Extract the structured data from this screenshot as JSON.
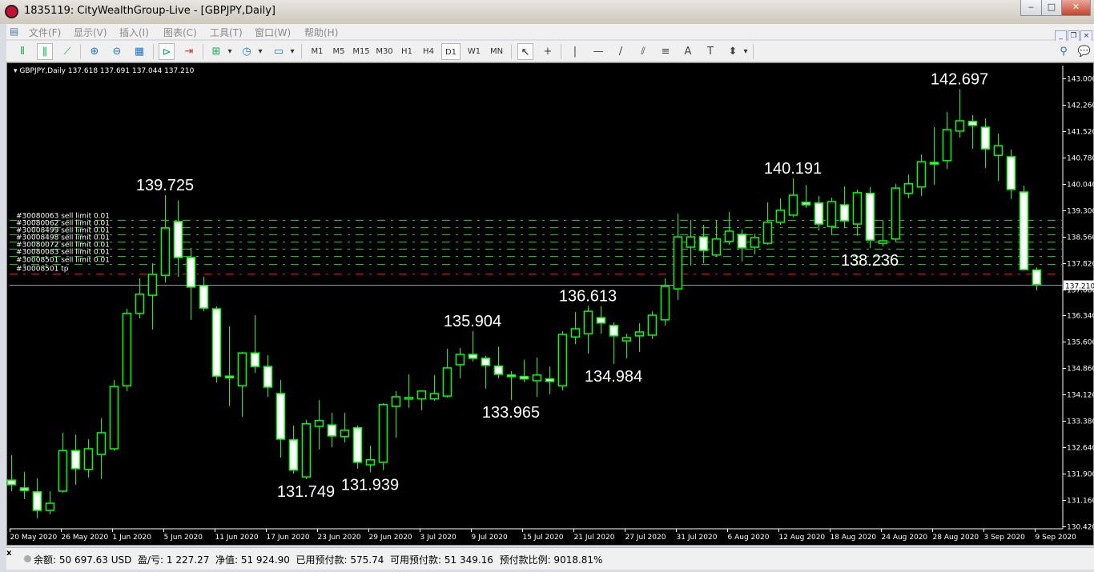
{
  "window": {
    "title": "1835119: CityWealthGroup-Live - [GBPJPY,Daily]",
    "minimize": "‒",
    "maximize": "□",
    "close": "✕"
  },
  "menu": [
    "文件(F)",
    "显示(V)",
    "插入(I)",
    "图表(C)",
    "工具(T)",
    "窗口(W)",
    "帮助(H)"
  ],
  "mdi_buttons": [
    "_",
    "❐",
    "×"
  ],
  "toolbar": {
    "timeframes": [
      "M1",
      "M5",
      "M15",
      "M30",
      "H1",
      "H4",
      "D1",
      "W1",
      "MN"
    ],
    "active_timeframe": "D1",
    "draw_tools": [
      "↖",
      "+",
      "|",
      "—",
      "/",
      "⫽",
      "≡",
      "A",
      "T",
      "⬍"
    ]
  },
  "chart": {
    "header": "GBPJPY,Daily  137.618 137.691 137.044 137.210",
    "bid_label": "137.210",
    "colors": {
      "bg": "#000000",
      "candle": "#00ff00",
      "bull_fill": "#000000",
      "bear_fill": "#ffffff",
      "order": "#00cc00",
      "tp": "#ff0000",
      "bid": "#8899aa"
    }
  },
  "chart_data": {
    "type": "candlestick",
    "symbol": "GBPJPY",
    "timeframe": "Daily",
    "ylim": [
      130.42,
      143.0
    ],
    "price_ticks": [
      "143.000",
      "142.260",
      "141.520",
      "140.780",
      "140.040",
      "139.300",
      "138.560",
      "137.820",
      "137.080",
      "136.340",
      "135.600",
      "134.860",
      "134.120",
      "133.380",
      "132.640",
      "131.900",
      "131.160",
      "130.420"
    ],
    "date_labels": [
      {
        "i": 0,
        "t": "20 May 2020"
      },
      {
        "i": 4,
        "t": "26 May 2020"
      },
      {
        "i": 8,
        "t": "1 Jun 2020"
      },
      {
        "i": 12,
        "t": "5 Jun 2020"
      },
      {
        "i": 16,
        "t": "11 Jun 2020"
      },
      {
        "i": 20,
        "t": "17 Jun 2020"
      },
      {
        "i": 24,
        "t": "23 Jun 2020"
      },
      {
        "i": 28,
        "t": "29 Jun 2020"
      },
      {
        "i": 32,
        "t": "3 Jul 2020"
      },
      {
        "i": 36,
        "t": "9 Jul 2020"
      },
      {
        "i": 40,
        "t": "15 Jul 2020"
      },
      {
        "i": 44,
        "t": "21 Jul 2020"
      },
      {
        "i": 48,
        "t": "27 Jul 2020"
      },
      {
        "i": 52,
        "t": "31 Jul 2020"
      },
      {
        "i": 56,
        "t": "6 Aug 2020"
      },
      {
        "i": 60,
        "t": "12 Aug 2020"
      },
      {
        "i": 64,
        "t": "18 Aug 2020"
      },
      {
        "i": 68,
        "t": "24 Aug 2020"
      },
      {
        "i": 72,
        "t": "28 Aug 2020"
      },
      {
        "i": 76,
        "t": "3 Sep 2020"
      },
      {
        "i": 80,
        "t": "9 Sep 2020"
      }
    ],
    "ohlc": [
      [
        131.72,
        132.42,
        131.41,
        131.59
      ],
      [
        131.5,
        131.95,
        131.19,
        131.43
      ],
      [
        131.39,
        131.77,
        130.65,
        130.87
      ],
      [
        130.87,
        131.41,
        130.76,
        131.07
      ],
      [
        131.41,
        133.05,
        131.37,
        132.55
      ],
      [
        132.55,
        133.0,
        131.59,
        132.04
      ],
      [
        132.02,
        132.87,
        131.79,
        132.6
      ],
      [
        132.44,
        133.46,
        131.75,
        133.05
      ],
      [
        132.6,
        134.53,
        132.55,
        134.35
      ],
      [
        134.37,
        136.53,
        134.22,
        136.4
      ],
      [
        136.4,
        137.39,
        136.26,
        136.94
      ],
      [
        136.91,
        137.81,
        135.95,
        137.5
      ],
      [
        137.47,
        139.725,
        137.27,
        138.8
      ],
      [
        138.98,
        139.58,
        137.43,
        137.97
      ],
      [
        137.97,
        138.24,
        136.22,
        137.14
      ],
      [
        137.18,
        137.43,
        136.46,
        136.55
      ],
      [
        136.53,
        136.6,
        134.46,
        134.64
      ],
      [
        134.64,
        136.04,
        133.8,
        134.6
      ],
      [
        134.37,
        135.32,
        133.5,
        135.29
      ],
      [
        135.29,
        136.35,
        134.73,
        134.91
      ],
      [
        134.91,
        135.23,
        134.06,
        134.33
      ],
      [
        134.15,
        134.53,
        132.35,
        132.87
      ],
      [
        132.85,
        133.25,
        131.9,
        132.0
      ],
      [
        131.81,
        133.41,
        131.749,
        133.3
      ],
      [
        133.23,
        133.97,
        132.58,
        133.39
      ],
      [
        133.27,
        133.61,
        132.64,
        132.96
      ],
      [
        132.94,
        133.61,
        132.78,
        133.12
      ],
      [
        133.19,
        133.25,
        132.04,
        132.22
      ],
      [
        132.15,
        132.69,
        131.939,
        132.29
      ],
      [
        132.22,
        133.88,
        132.0,
        133.84
      ],
      [
        133.79,
        134.22,
        132.91,
        134.06
      ],
      [
        134.0,
        134.69,
        133.75,
        134.04
      ],
      [
        134.0,
        134.22,
        133.68,
        134.22
      ],
      [
        134.0,
        134.67,
        133.95,
        134.15
      ],
      [
        134.08,
        135.41,
        134.04,
        134.87
      ],
      [
        134.96,
        135.43,
        134.58,
        135.25
      ],
      [
        135.25,
        135.904,
        135.05,
        135.14
      ],
      [
        135.14,
        135.21,
        134.29,
        134.94
      ],
      [
        134.92,
        135.47,
        134.58,
        134.69
      ],
      [
        134.67,
        134.78,
        133.965,
        134.63
      ],
      [
        134.63,
        135.1,
        134.47,
        134.56
      ],
      [
        134.51,
        135.16,
        134.06,
        134.67
      ],
      [
        134.56,
        134.91,
        134.13,
        134.49
      ],
      [
        134.37,
        135.9,
        134.24,
        135.81
      ],
      [
        135.74,
        136.44,
        135.54,
        135.97
      ],
      [
        135.83,
        136.613,
        135.27,
        136.46
      ],
      [
        136.28,
        136.6,
        135.83,
        136.13
      ],
      [
        136.06,
        136.15,
        134.984,
        135.77
      ],
      [
        135.63,
        135.83,
        135.14,
        135.72
      ],
      [
        135.77,
        136.13,
        135.32,
        135.88
      ],
      [
        135.79,
        136.46,
        135.68,
        136.35
      ],
      [
        136.22,
        137.38,
        136.06,
        137.16
      ],
      [
        137.09,
        139.21,
        136.78,
        138.55
      ],
      [
        138.26,
        139.02,
        137.74,
        138.55
      ],
      [
        138.55,
        138.89,
        137.81,
        138.17
      ],
      [
        138.04,
        139.02,
        137.99,
        138.49
      ],
      [
        138.42,
        139.25,
        138.33,
        138.71
      ],
      [
        138.62,
        138.76,
        137.86,
        138.24
      ],
      [
        138.26,
        138.64,
        138.06,
        138.53
      ],
      [
        138.37,
        139.52,
        138.33,
        138.96
      ],
      [
        138.96,
        139.63,
        138.89,
        139.3
      ],
      [
        139.16,
        140.191,
        139.1,
        139.72
      ],
      [
        139.52,
        140.01,
        139.36,
        139.45
      ],
      [
        139.5,
        139.7,
        138.73,
        138.91
      ],
      [
        138.84,
        139.65,
        138.6,
        139.54
      ],
      [
        139.45,
        139.97,
        138.8,
        139.0
      ],
      [
        138.91,
        139.88,
        138.58,
        139.79
      ],
      [
        139.77,
        139.95,
        138.236,
        138.46
      ],
      [
        138.37,
        139.02,
        138.28,
        138.44
      ],
      [
        138.49,
        140.04,
        138.4,
        139.92
      ],
      [
        139.77,
        140.3,
        139.63,
        140.04
      ],
      [
        139.95,
        140.87,
        139.7,
        140.66
      ],
      [
        140.64,
        141.63,
        140.01,
        140.6
      ],
      [
        140.69,
        142.06,
        140.46,
        141.56
      ],
      [
        141.52,
        142.697,
        141.34,
        141.81
      ],
      [
        141.79,
        141.97,
        141.02,
        141.68
      ],
      [
        141.63,
        141.88,
        140.48,
        141.02
      ],
      [
        140.84,
        141.45,
        140.12,
        141.11
      ],
      [
        140.8,
        141.0,
        139.61,
        139.88
      ],
      [
        139.81,
        139.99,
        137.61,
        137.63
      ],
      [
        137.618,
        137.691,
        137.044,
        137.21
      ]
    ],
    "annotations": [
      {
        "i": 12,
        "text": "139.725",
        "pos": "above"
      },
      {
        "i": 23,
        "text": "131.749",
        "pos": "below"
      },
      {
        "i": 28,
        "text": "131.939",
        "pos": "below"
      },
      {
        "i": 36,
        "text": "135.904",
        "pos": "above"
      },
      {
        "i": 39,
        "text": "133.965",
        "pos": "below"
      },
      {
        "i": 45,
        "text": "136.613",
        "pos": "above"
      },
      {
        "i": 47,
        "text": "134.984",
        "pos": "below"
      },
      {
        "i": 61,
        "text": "140.191",
        "pos": "above"
      },
      {
        "i": 67,
        "text": "138.236",
        "pos": "below"
      },
      {
        "i": 74,
        "text": "142.697",
        "pos": "above"
      }
    ],
    "orders": [
      {
        "label": "#30080063 sell limit 0.01",
        "price": 139.02,
        "kind": "sell"
      },
      {
        "label": "#30080062 sell limit 0.01",
        "price": 138.82,
        "kind": "sell"
      },
      {
        "label": "#30008499 sell limit 0.01",
        "price": 138.62,
        "kind": "sell"
      },
      {
        "label": "#30008498 sell limit 0.01",
        "price": 138.42,
        "kind": "sell"
      },
      {
        "label": "#30080072 sell limit 0.01",
        "price": 138.22,
        "kind": "sell"
      },
      {
        "label": "#30080083 sell limit 0.01",
        "price": 138.01,
        "kind": "sell"
      },
      {
        "label": "#30008501 sell limit 0.01",
        "price": 137.79,
        "kind": "sell"
      },
      {
        "label": "#30008501 tp",
        "price": 137.52,
        "kind": "tp"
      }
    ],
    "bid": 137.21
  },
  "status": {
    "text": "余额: 50 697.63 USD  盈/亏: 1 227.27  净值: 51 924.90  已用预付款: 575.74  可用预付款: 51 349.16  预付款比例: 9018.81%",
    "close": "x"
  }
}
